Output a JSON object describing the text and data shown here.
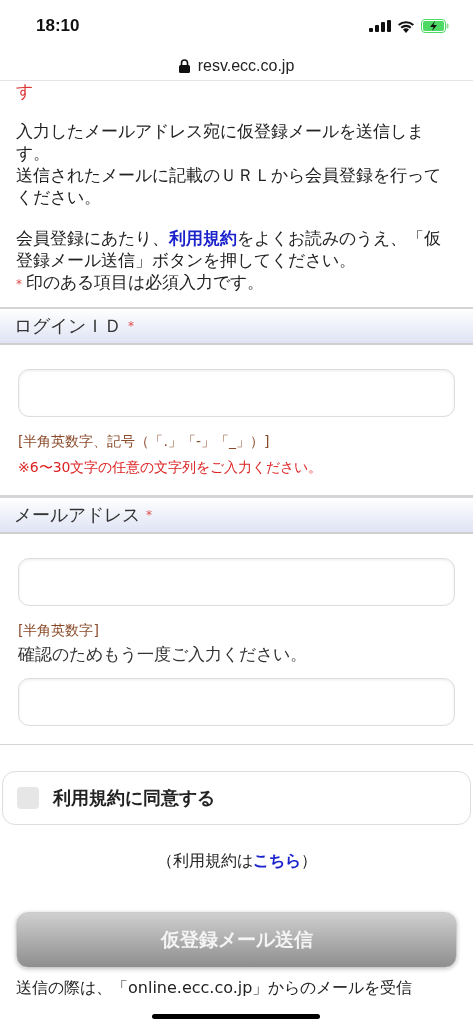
{
  "status_bar": {
    "time": "18:10"
  },
  "address_bar": {
    "url": "resv.ecc.co.jp"
  },
  "intro": {
    "cut_line": "す",
    "paragraphs": [
      [
        {
          "kind": "text",
          "text": "入力したメールアドレス宛に仮登録メールを送信します。"
        }
      ],
      [
        {
          "kind": "text",
          "text": "送信されたメールに記載のＵＲＬから会員登録を行ってください。"
        }
      ],
      [
        {
          "kind": "text",
          "text": "会員登録にあたり、"
        },
        {
          "kind": "link",
          "text": "利用規約"
        },
        {
          "kind": "text",
          "text": "をよくお読みのうえ、「仮登録メール送信」ボタンを押してください。"
        }
      ]
    ],
    "required_note": {
      "mark": "*",
      "text": "印のある項目は必須入力です。"
    }
  },
  "form_sections": [
    {
      "label": "ログインＩＤ",
      "required_mark": "*",
      "items": [
        {
          "kind": "input"
        },
        {
          "kind": "format_hint",
          "text": "[半角英数字、記号（「.」「-」「_」）]"
        },
        {
          "kind": "warning",
          "text": "※6〜30文字の任意の文字列をご入力ください。"
        }
      ]
    },
    {
      "label": "メールアドレス",
      "required_mark": "*",
      "items": [
        {
          "kind": "input"
        },
        {
          "kind": "format_hint",
          "text": "[半角英数字]"
        },
        {
          "kind": "note",
          "text": "確認のためもう一度ご入力ください。"
        },
        {
          "kind": "input"
        }
      ]
    }
  ],
  "agree": {
    "label": "利用規約に同意する",
    "checked": false
  },
  "terms_link": {
    "prefix": "（利用規約は",
    "link": "こちら",
    "suffix": "）"
  },
  "submit": {
    "label": "仮登録メール送信",
    "disabled": true
  },
  "footer_text": "送信の際は、「online.ecc.co.jp」からのメールを受信"
}
